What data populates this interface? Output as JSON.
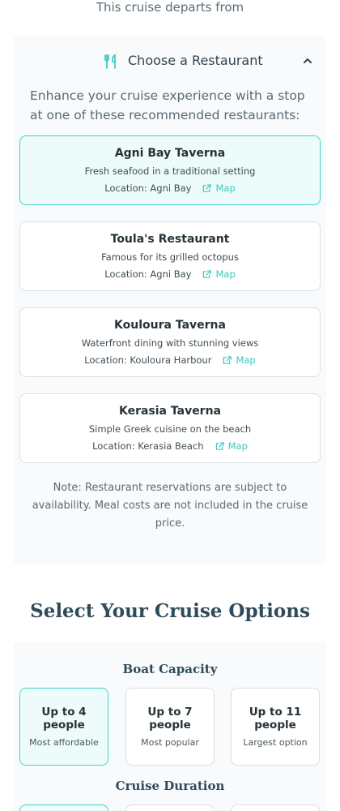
{
  "departure": {
    "text": "This cruise departs from"
  },
  "restaurants": {
    "title": "Choose a Restaurant",
    "intro": "Enhance your cruise experience with a stop at one of these recommended restaurants:",
    "map_label": "Map",
    "items": [
      {
        "name": "Agni Bay Taverna",
        "description": "Fresh seafood in a traditional setting",
        "location": "Location: Agni Bay",
        "selected": true
      },
      {
        "name": "Toula's Restaurant",
        "description": "Famous for its grilled octopus",
        "location": "Location: Agni Bay",
        "selected": false
      },
      {
        "name": "Kouloura Taverna",
        "description": "Waterfront dining with stunning views",
        "location": "Location: Kouloura Harbour",
        "selected": false
      },
      {
        "name": "Kerasia Taverna",
        "description": "Simple Greek cuisine on the beach",
        "location": "Location: Kerasia Beach",
        "selected": false
      }
    ],
    "note": "Note: Restaurant reservations are subject to availability. Meal costs are not included in the cruise price."
  },
  "cruise_options": {
    "title": "Select Your Cruise Options",
    "capacity": {
      "title": "Boat Capacity",
      "options": [
        {
          "label": "Up to 4 people",
          "sub": "Most affordable",
          "selected": true
        },
        {
          "label": "Up to 7 people",
          "sub": "Most popular",
          "selected": false
        },
        {
          "label": "Up to 11 people",
          "sub": "Largest option",
          "selected": false
        }
      ]
    },
    "duration": {
      "title": "Cruise Duration"
    }
  },
  "colors": {
    "accent": "#3cc8c0",
    "heading": "#2f4b5a",
    "selected_bg": "#eefbfb",
    "selected_border": "#45d3cb"
  }
}
